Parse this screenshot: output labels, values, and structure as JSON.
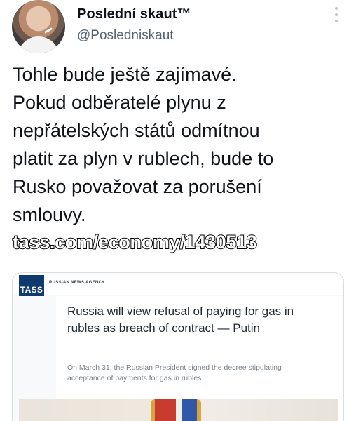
{
  "author": {
    "display_name": "Poslední skaut™",
    "handle": "@Posledniskaut"
  },
  "tweet": {
    "text": "Tohle bude ještě zajímavé.\nPokud odběratelé plynu z\nnepřátelských států odmítnou\nplatit za plyn v rublech, bude to\nRusko považovat za porušení\nsmlouvy.",
    "link": "tass.com/economy/1430513"
  },
  "card": {
    "logo_text": "TASS",
    "agency_label": "RUSSIAN NEWS AGENCY",
    "title": "Russia will view refusal of paying for gas in rubles as breach of contract — Putin",
    "subtitle": "On March 31, the Russian President signed the decree stipulating acceptance of payments for gas in rubles"
  },
  "icons": {
    "more": "more-vertical-icon",
    "avatar": "profile-avatar"
  }
}
